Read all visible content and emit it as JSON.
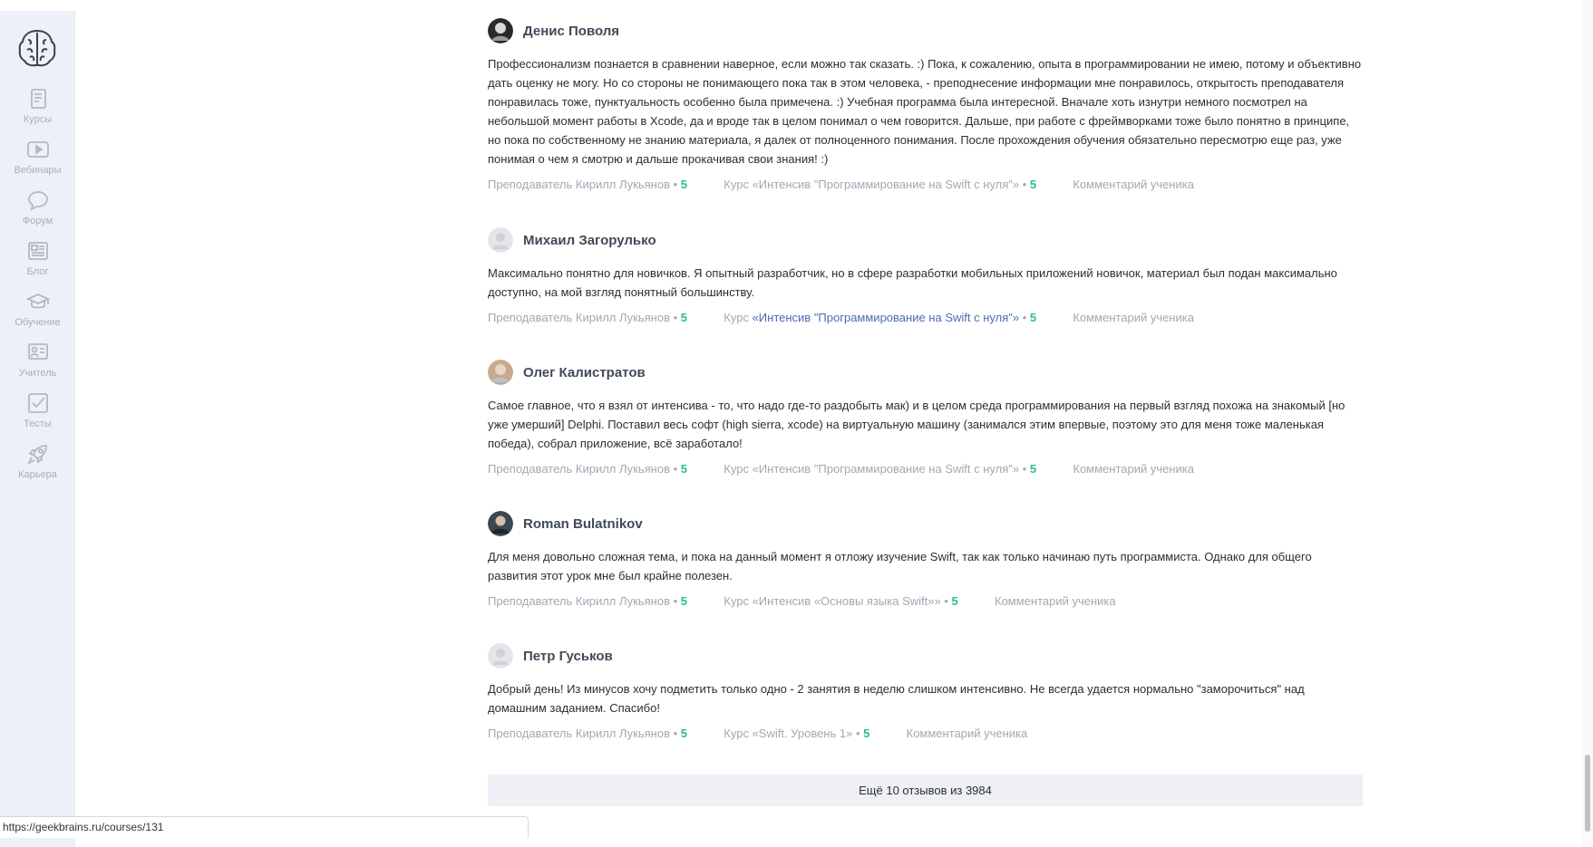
{
  "sidebar": {
    "logo_icon": "brain-logo-icon",
    "items": [
      {
        "label": "Курсы",
        "icon": "book-icon"
      },
      {
        "label": "Вебинары",
        "icon": "play-icon"
      },
      {
        "label": "Форум",
        "icon": "chat-bubble-icon"
      },
      {
        "label": "Блог",
        "icon": "newspaper-icon"
      },
      {
        "label": "Обучение",
        "icon": "graduation-cap-icon"
      },
      {
        "label": "Учитель",
        "icon": "teacher-board-icon"
      },
      {
        "label": "Тесты",
        "icon": "checkbox-icon"
      },
      {
        "label": "Карьера",
        "icon": "rocket-icon"
      }
    ]
  },
  "reviews": [
    {
      "name": "Денис Поволя",
      "text": "Профессионализм познается в сравнении наверное, если можно так сказать. :) Пока, к сожалению, опыта в программировании не имею, потому и объективно дать оценку не могу. Но со стороны не понимающего пока так в этом человека, - преподнесение информации мне понравилось, открытость преподавателя понравилась тоже, пунктуальность особенно была примечена. :) Учебная программа была интересной. Вначале хоть изнутри немного посмотрел на небольшой момент работы в Xcode, да и вроде так в целом понимал о чем говорится. Дальше, при работе с фреймворками тоже было понятно в принципе, но пока по собственному не знанию материала, я далек от полноценного понимания. После прохождения обучения обязательно пересмотрю еще раз, уже понимая о чем я смотрю и дальше прокачивая свои знания! :)",
      "teacher": "Преподаватель Кирилл Лукьянов",
      "teacher_score": "5",
      "course_prefix": "Курс ",
      "course": "«Интенсив \"Программирование на Swift с нуля\"»",
      "course_score": "5",
      "comment_label": "Комментарий ученика"
    },
    {
      "name": "Михаил Загорулько",
      "text": "Максимально понятно для новичков. Я опытный разработчик, но в сфере разработки мобильных приложений новичок, материал был подан максимально доступно, на мой взгляд понятный большинству.",
      "teacher": "Преподаватель Кирилл Лукьянов",
      "teacher_score": "5",
      "course_prefix": "Курс ",
      "course": "«Интенсив \"Программирование на Swift с нуля\"»",
      "course_score": "5",
      "comment_label": "Комментарий ученика"
    },
    {
      "name": "Олег Калистратов",
      "text": "Самое главное, что я взял от интенсива - то, что надо где-то раздобыть мак) и в целом среда программирования на первый взгляд похожа на знакомый [но уже умерший] Delphi. Поставил весь софт (high sierra, xcode) на виртуальную машину (занимался этим впервые, поэтому это для меня тоже маленькая победа), собрал приложение, всё заработало!",
      "teacher": "Преподаватель Кирилл Лукьянов",
      "teacher_score": "5",
      "course_prefix": "Курс ",
      "course": "«Интенсив \"Программирование на Swift с нуля\"»",
      "course_score": "5",
      "comment_label": "Комментарий ученика"
    },
    {
      "name": "Roman Bulatnikov",
      "text": "Для меня довольно сложная тема, и пока на данный момент я отложу изучение Swift, так как только начинаю путь программиста. Однако для общего развития этот урок мне был крайне полезен.",
      "teacher": "Преподаватель Кирилл Лукьянов",
      "teacher_score": "5",
      "course_prefix": "Курс ",
      "course": "«Интенсив «Основы языка Swift»»",
      "course_score": "5",
      "comment_label": "Комментарий ученика"
    },
    {
      "name": "Петр Гуськов",
      "text": "Добрый день! Из минусов хочу подметить только одно - 2 занятия в неделю слишком интенсивно. Не всегда удается нормально \"заморочиться\" над домашним заданием. Спасибо!",
      "teacher": "Преподаватель Кирилл Лукьянов",
      "teacher_score": "5",
      "course_prefix": "Курс ",
      "course": "«Swift. Уровень 1»",
      "course_score": "5",
      "comment_label": "Комментарий ученика"
    }
  ],
  "more_button": "Ещё 10 отзывов из 3984",
  "status_url": "https://geekbrains.ru/courses/131",
  "colors": {
    "sidebar_bg": "#eef0f8",
    "score_green": "#2bbf7b",
    "meta_gray": "#a1a8b3",
    "link_blue": "#4a6db0"
  }
}
